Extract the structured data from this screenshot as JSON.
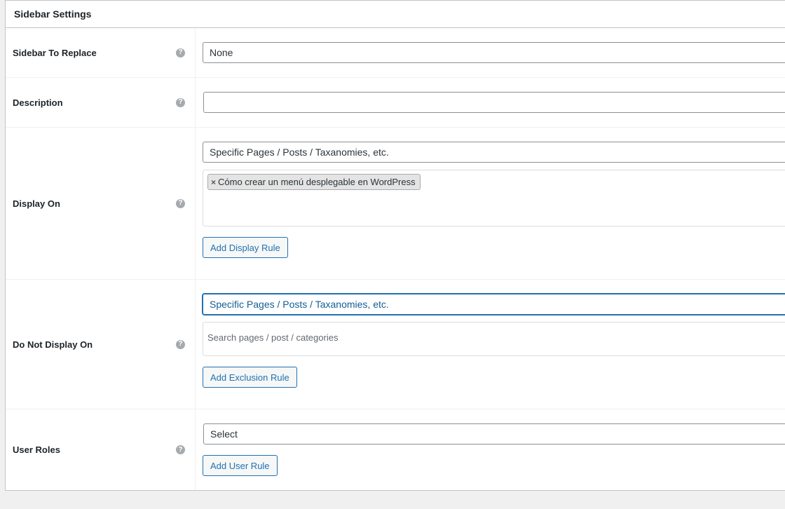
{
  "panel": {
    "title": "Sidebar Settings"
  },
  "rows": {
    "sidebar_to_replace": {
      "label": "Sidebar To Replace",
      "value": "None"
    },
    "description": {
      "label": "Description",
      "value": ""
    },
    "display_on": {
      "label": "Display On",
      "select_value": "Specific Pages / Posts / Taxanomies, etc.",
      "tag": "Cómo crear un menú desplegable en WordPress",
      "tag_remove": "×",
      "button": "Add Display Rule"
    },
    "do_not_display_on": {
      "label": "Do Not Display On",
      "select_value": "Specific Pages / Posts / Taxanomies, etc.",
      "search_placeholder": "Search pages / post / categories",
      "button": "Add Exclusion Rule"
    },
    "user_roles": {
      "label": "User Roles",
      "select_value": "Select",
      "button": "Add User Rule"
    }
  },
  "help_glyph": "?",
  "icons": {
    "help": "question-circle-icon",
    "remove": "close-icon"
  }
}
